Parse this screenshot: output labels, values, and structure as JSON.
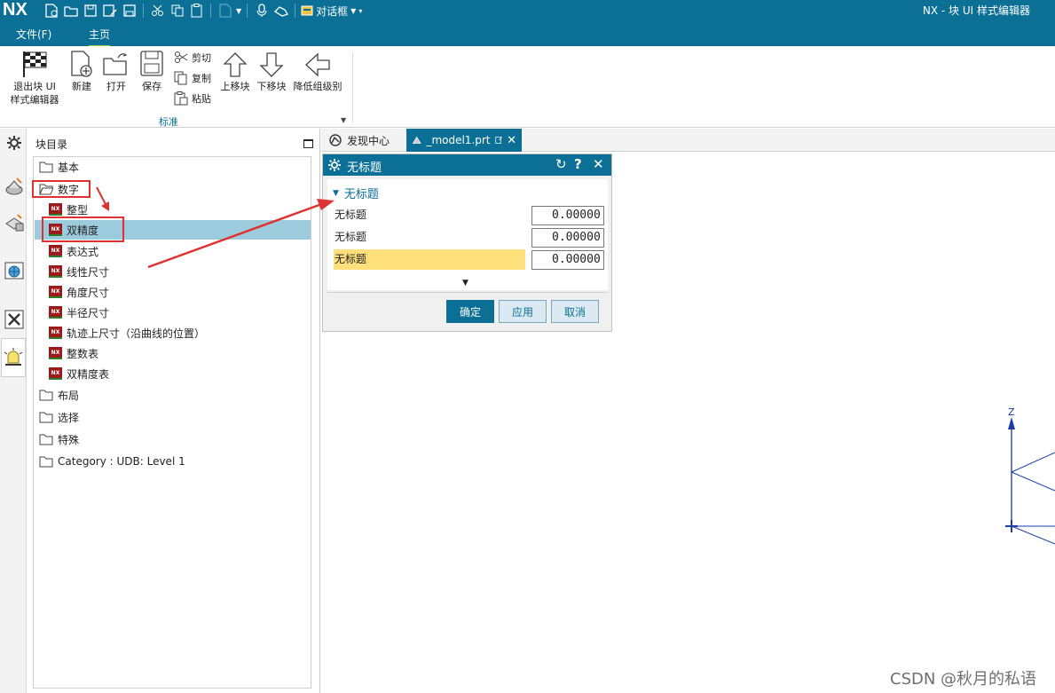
{
  "titlebar": {
    "logo": "NX",
    "dialog_dropdown": "对话框",
    "app_title": "NX - 块 UI 样式编辑器"
  },
  "menubar": {
    "file": "文件(F)",
    "home": "主页"
  },
  "ribbon": {
    "exit_label": "退出块 UI\n样式编辑器",
    "new_label": "新建",
    "open_label": "打开",
    "save_label": "保存",
    "cut_label": "剪切",
    "copy_label": "复制",
    "paste_label": "粘贴",
    "move_up_label": "上移块",
    "move_down_label": "下移块",
    "demote_label": "降低组级别",
    "group_label": "标准"
  },
  "nav_panel": {
    "title": "块目录",
    "tree": [
      {
        "label": "基本",
        "type": "folder"
      },
      {
        "label": "数字",
        "type": "folder-open"
      },
      {
        "label": "整型",
        "type": "block"
      },
      {
        "label": "双精度",
        "type": "block",
        "selected": true
      },
      {
        "label": "表达式",
        "type": "block"
      },
      {
        "label": "线性尺寸",
        "type": "block"
      },
      {
        "label": "角度尺寸",
        "type": "block"
      },
      {
        "label": "半径尺寸",
        "type": "block"
      },
      {
        "label": "轨迹上尺寸（沿曲线的位置）",
        "type": "block"
      },
      {
        "label": "整数表",
        "type": "block"
      },
      {
        "label": "双精度表",
        "type": "block"
      },
      {
        "label": "布局",
        "type": "folder"
      },
      {
        "label": "选择",
        "type": "folder"
      },
      {
        "label": "特殊",
        "type": "folder"
      },
      {
        "label": "Category : UDB: Level 1",
        "type": "folder"
      }
    ]
  },
  "tabs": {
    "discovery": "发现中心",
    "model": "_model1.prt"
  },
  "dialog": {
    "title": "无标题",
    "section": "无标题",
    "rows": [
      {
        "label": "无标题",
        "value": "0.00000"
      },
      {
        "label": "无标题",
        "value": "0.00000"
      },
      {
        "label": "无标题",
        "value": "0.00000"
      }
    ],
    "ok": "确定",
    "apply": "应用",
    "cancel": "取消"
  },
  "viewport": {
    "axis_z": "Z"
  },
  "watermark": "CSDN @秋月的私语",
  "colors": {
    "brand": "#0b6f96",
    "selection": "#9ccbdd",
    "highlight_row": "#fde07c",
    "annotation": "#e03131"
  }
}
